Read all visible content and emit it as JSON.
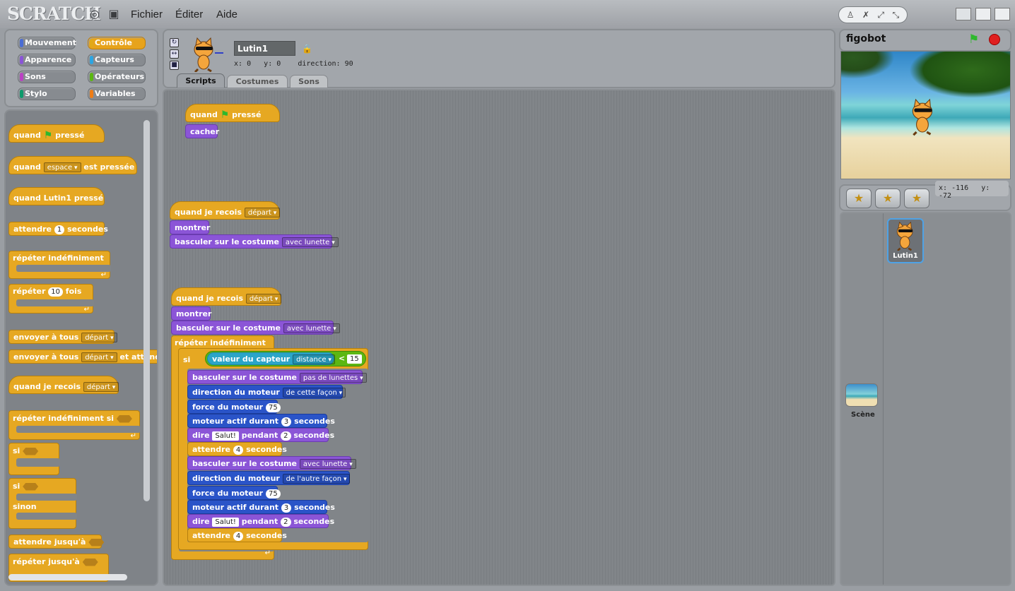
{
  "app": {
    "logo": "SCRATCH",
    "menus": [
      "Fichier",
      "Éditer",
      "Aide"
    ]
  },
  "categories": [
    {
      "label": "Mouvement",
      "color": "#4a6cd4"
    },
    {
      "label": "Contrôle",
      "color": "#e1a91a",
      "active": true
    },
    {
      "label": "Apparence",
      "color": "#8a55d7"
    },
    {
      "label": "Capteurs",
      "color": "#2ca5e2"
    },
    {
      "label": "Sons",
      "color": "#bb42c3"
    },
    {
      "label": "Opérateurs",
      "color": "#5cb712"
    },
    {
      "label": "Stylo",
      "color": "#0e9a6c"
    },
    {
      "label": "Variables",
      "color": "#ee7d16"
    }
  ],
  "palette": {
    "when_flag": [
      "quand",
      "pressé"
    ],
    "when_key": [
      "quand",
      "espace",
      "est pressée"
    ],
    "when_sprite": "quand Lutin1 pressé",
    "wait": [
      "attendre",
      "1",
      "secondes"
    ],
    "forever": "répéter indéfiniment",
    "repeat": [
      "répéter",
      "10",
      "fois"
    ],
    "broadcast": [
      "envoyer à tous",
      "départ"
    ],
    "broadcast_wait": [
      "envoyer à tous",
      "départ",
      "et attendre"
    ],
    "when_receive": [
      "quand je recois",
      "départ"
    ],
    "forever_if": "répéter indéfiniment si",
    "if": "si",
    "if_else": [
      "si",
      "sinon"
    ],
    "wait_until": "attendre jusqu'à",
    "repeat_until": "répéter jusqu'à"
  },
  "sprite": {
    "name": "Lutin1",
    "x_label": "x:",
    "x": "0",
    "y_label": "y:",
    "y": "0",
    "dir_label": "direction:",
    "dir": "90"
  },
  "tabs": [
    "Scripts",
    "Costumes",
    "Sons"
  ],
  "script1": {
    "hat": [
      "quand",
      "pressé"
    ],
    "hide": "cacher"
  },
  "script2": {
    "hat": [
      "quand je recois",
      "départ"
    ],
    "show": "montrer",
    "switch": [
      "basculer sur le costume",
      "avec lunette"
    ]
  },
  "script3": {
    "hat": [
      "quand je recois",
      "départ"
    ],
    "show": "montrer",
    "switch": [
      "basculer sur le costume",
      "avec lunette"
    ],
    "forever": "répéter indéfiniment",
    "if": "si",
    "sensor": [
      "valeur du capteur",
      "distance"
    ],
    "lt": "<",
    "lt_val": "15",
    "body": [
      {
        "k": "look",
        "t": [
          "basculer sur le costume"
        ],
        "d": "pas de lunettes"
      },
      {
        "k": "mot",
        "t": [
          "direction du moteur"
        ],
        "d": "de cette façon"
      },
      {
        "k": "mot",
        "t": [
          "force du moteur"
        ],
        "n": "75"
      },
      {
        "k": "mot",
        "t": [
          "moteur actif durant",
          "secondes"
        ],
        "n": "3"
      },
      {
        "k": "look",
        "t": [
          "dire",
          "pendant",
          "secondes"
        ],
        "s": "Salut!",
        "n": "2"
      },
      {
        "k": "ctl",
        "t": [
          "attendre",
          "secondes"
        ],
        "n": "4"
      },
      {
        "k": "look",
        "t": [
          "basculer sur le costume"
        ],
        "d": "avec lunette"
      },
      {
        "k": "mot",
        "t": [
          "direction du moteur"
        ],
        "d": "de l'autre façon"
      },
      {
        "k": "mot",
        "t": [
          "force du moteur"
        ],
        "n": "75"
      },
      {
        "k": "mot",
        "t": [
          "moteur actif durant",
          "secondes"
        ],
        "n": "3"
      },
      {
        "k": "look",
        "t": [
          "dire",
          "pendant",
          "secondes"
        ],
        "s": "Salut!",
        "n": "2"
      },
      {
        "k": "ctl",
        "t": [
          "attendre",
          "secondes"
        ],
        "n": "4"
      }
    ]
  },
  "stage": {
    "project": "figobot",
    "mouse_x_label": "x:",
    "mouse_x": "-116",
    "mouse_y_label": "y:",
    "mouse_y": "-72",
    "stage_label": "Scène",
    "sprite_label": "Lutin1"
  }
}
